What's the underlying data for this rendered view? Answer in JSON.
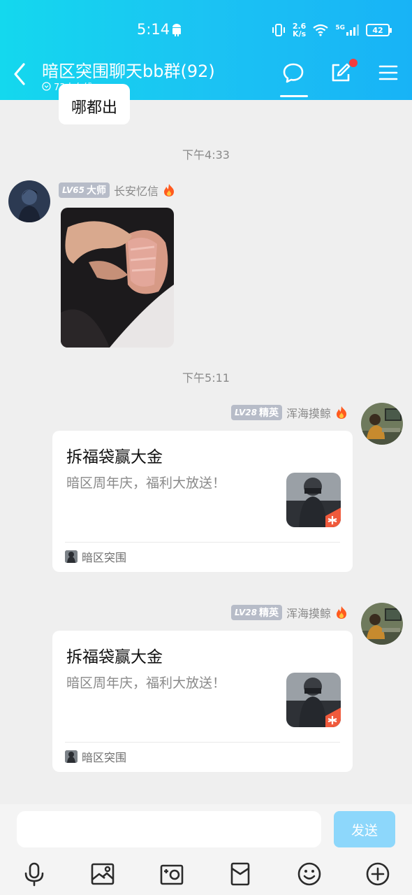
{
  "status_bar": {
    "time": "5:14",
    "net_speed_top": "2.6",
    "net_speed_bottom": "K/s",
    "network": "5G",
    "battery": "42"
  },
  "header": {
    "title": "暗区突围聊天bb群(92)",
    "online": "73人在线"
  },
  "previous_message": {
    "text": "哪都出"
  },
  "timestamps": [
    "下午4:33",
    "下午5:11"
  ],
  "messages": [
    {
      "badge_level": "LV65",
      "badge_title": "大师",
      "sender": "长安忆信",
      "type": "image"
    },
    {
      "badge_level": "LV28",
      "badge_title": "精英",
      "sender": "浑海摸鲸",
      "type": "card",
      "card_title": "拆福袋赢大金",
      "card_desc": "暗区周年庆，福利大放送！",
      "card_source": "暗区突围"
    },
    {
      "badge_level": "LV28",
      "badge_title": "精英",
      "sender": "浑海摸鲸",
      "type": "card",
      "card_title": "拆福袋赢大金",
      "card_desc": "暗区周年庆，福利大放送！",
      "card_source": "暗区突围"
    }
  ],
  "input": {
    "value": "",
    "send_label": "发送"
  },
  "colors": {
    "header_start": "#14d8ee",
    "header_end": "#18b3f6",
    "send_button": "#8dd7fb",
    "badge": "#b7bcc8",
    "notification_dot": "#f43d3d"
  },
  "icons": [
    "back-icon",
    "chat-icon",
    "edit-icon",
    "menu-icon",
    "fire-icon",
    "mic-icon",
    "image-icon",
    "camera-icon",
    "red-packet-icon",
    "emoji-icon",
    "plus-icon"
  ]
}
